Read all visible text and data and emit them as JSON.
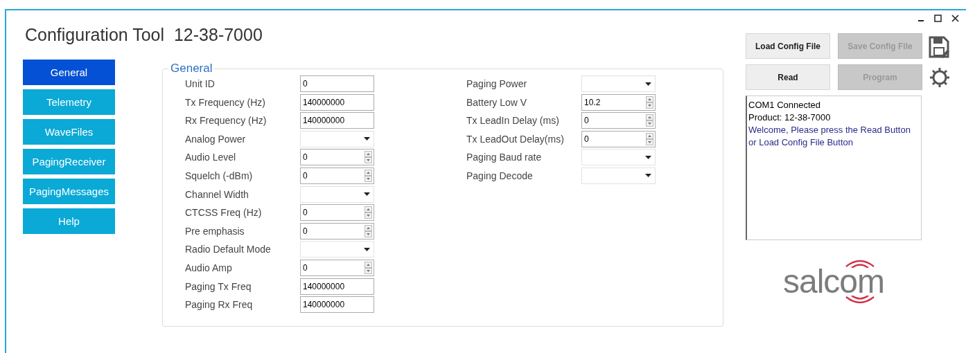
{
  "window": {
    "title": "Configuration Tool  12-38-7000"
  },
  "sidebar": {
    "items": [
      {
        "label": "General",
        "selected": true
      },
      {
        "label": "Telemetry",
        "selected": false
      },
      {
        "label": "WaveFiles",
        "selected": false
      },
      {
        "label": "PagingReceiver",
        "selected": false
      },
      {
        "label": "PagingMessages",
        "selected": false
      },
      {
        "label": "Help",
        "selected": false
      }
    ]
  },
  "group": {
    "title": "General",
    "left_fields": [
      {
        "label": "Unit ID",
        "kind": "text",
        "value": "0"
      },
      {
        "label": "Tx Frequency (Hz)",
        "kind": "text",
        "value": "140000000"
      },
      {
        "label": "Rx Frequency (Hz)",
        "kind": "text",
        "value": "140000000"
      },
      {
        "label": "Analog Power",
        "kind": "dropdown"
      },
      {
        "label": "Audio Level",
        "kind": "spinner",
        "value": "0"
      },
      {
        "label": "Squelch (-dBm)",
        "kind": "spinner",
        "value": "0"
      },
      {
        "label": "Channel Width",
        "kind": "dropdown"
      },
      {
        "label": "CTCSS Freq (Hz)",
        "kind": "spinner",
        "value": "0"
      },
      {
        "label": "Pre emphasis",
        "kind": "spinner",
        "value": "0"
      },
      {
        "label": "Radio Default Mode",
        "kind": "dropdown"
      },
      {
        "label": "Audio Amp",
        "kind": "spinner",
        "value": "0"
      },
      {
        "label": "Paging Tx Freq",
        "kind": "text",
        "value": "140000000"
      },
      {
        "label": "Paging Rx Freq",
        "kind": "text",
        "value": "140000000"
      }
    ],
    "right_fields": [
      {
        "label": "Paging Power",
        "kind": "dropdown"
      },
      {
        "label": "Battery Low V",
        "kind": "spinner",
        "value": "10.2"
      },
      {
        "label": "Tx LeadIn Delay (ms)",
        "kind": "spinner",
        "value": "0"
      },
      {
        "label": "Tx LeadOut Delay(ms)",
        "kind": "spinner",
        "value": "0"
      },
      {
        "label": "Paging Baud rate",
        "kind": "dropdown"
      },
      {
        "label": "Paging Decode",
        "kind": "dropdown"
      }
    ]
  },
  "actions": [
    {
      "label": "Load Config File",
      "disabled": false
    },
    {
      "label": "Save Config File",
      "disabled": true
    },
    {
      "label": "Read",
      "disabled": false
    },
    {
      "label": "Program",
      "disabled": true
    }
  ],
  "log": [
    {
      "text": "COM1  Connected",
      "color": "#000000"
    },
    {
      "text": "Product: 12-38-7000",
      "color": "#000000"
    },
    {
      "text": "Welcome, Please press the Read Button",
      "color": "#2a2a8c"
    },
    {
      "text": "or Load Config File Button",
      "color": "#2a2a8c"
    }
  ],
  "logo": {
    "text": "salcom"
  }
}
